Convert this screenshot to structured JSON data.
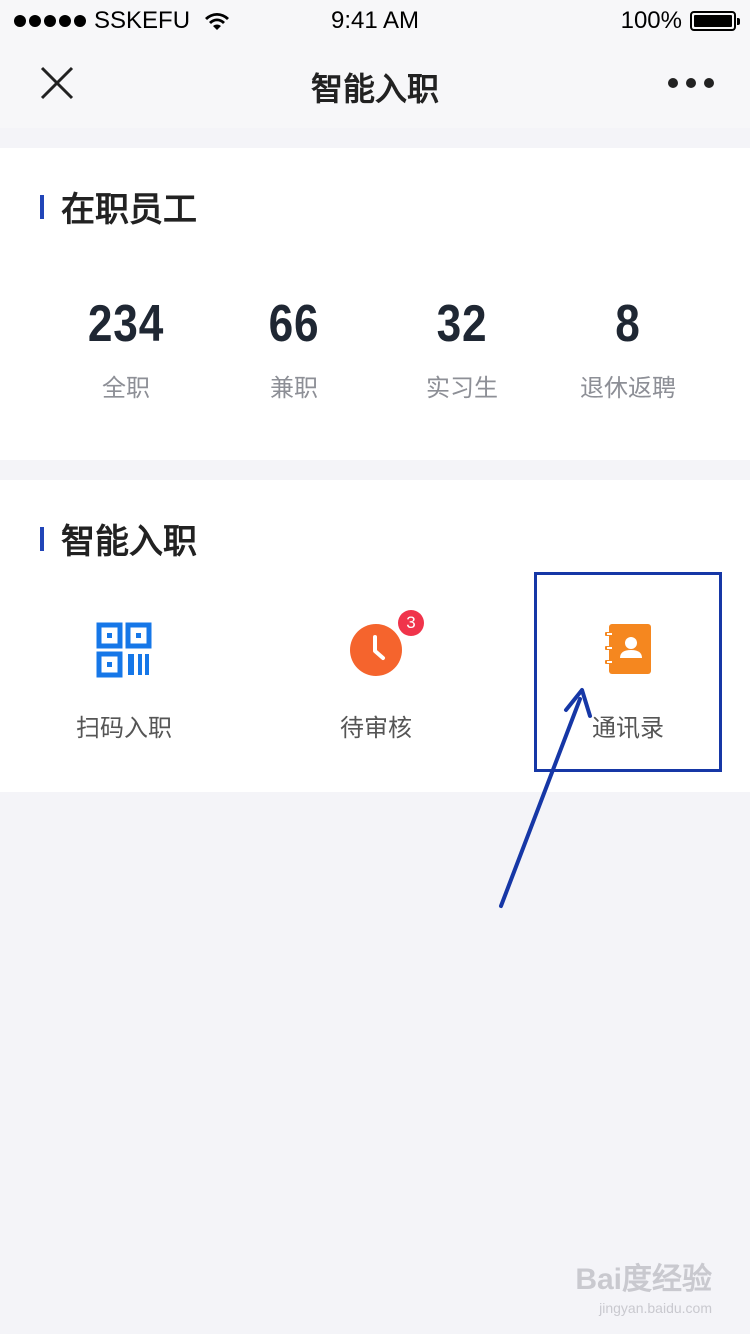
{
  "status_bar": {
    "carrier": "SSKEFU",
    "time": "9:41 AM",
    "battery": "100%"
  },
  "nav": {
    "title": "智能入职"
  },
  "employees": {
    "title": "在职员工",
    "stats": [
      {
        "value": "234",
        "label": "全职"
      },
      {
        "value": "66",
        "label": "兼职"
      },
      {
        "value": "32",
        "label": "实习生"
      },
      {
        "value": "8",
        "label": "退休返聘"
      }
    ]
  },
  "onboarding": {
    "title": "智能入职",
    "tools": [
      {
        "label": "扫码入职",
        "icon": "qr-code-icon",
        "color": "#1677e8"
      },
      {
        "label": "待审核",
        "icon": "clock-icon",
        "color": "#f5642d",
        "badge": "3"
      },
      {
        "label": "通讯录",
        "icon": "contacts-book-icon",
        "color": "#f5871f"
      }
    ]
  },
  "watermark": {
    "main": "Bai度经验",
    "sub": "jingyan.baidu.com"
  }
}
